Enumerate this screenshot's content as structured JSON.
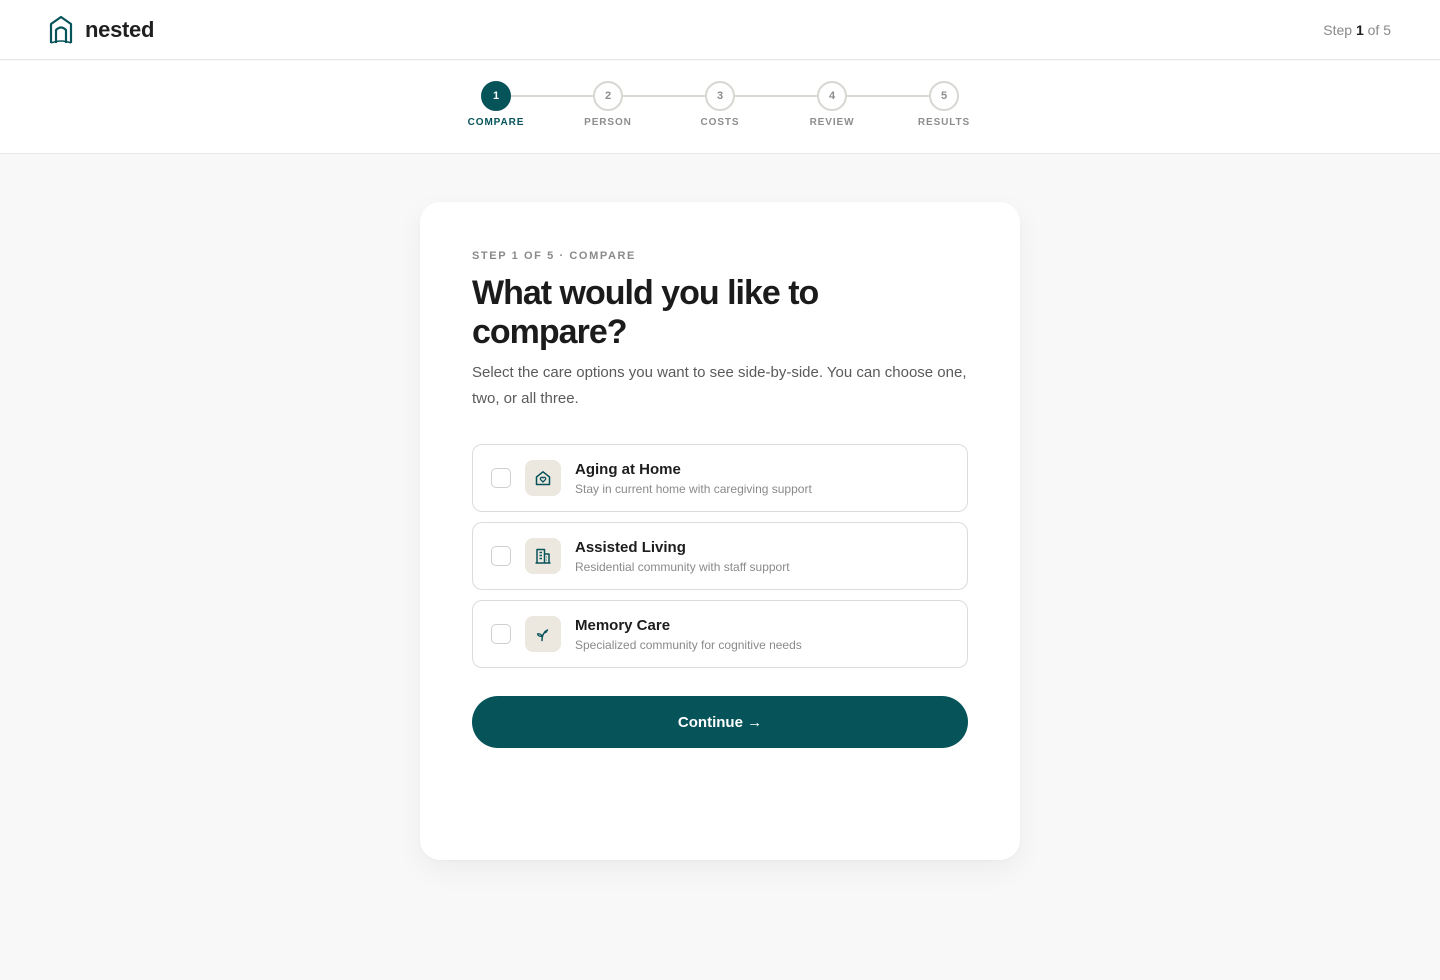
{
  "header": {
    "brand_name": "nested",
    "logo_icon": "house-arch-icon",
    "step_prefix": "Step ",
    "step_current": "1",
    "step_suffix": " of 5"
  },
  "progress": {
    "steps": [
      {
        "number": "1",
        "label": "COMPARE",
        "active": true
      },
      {
        "number": "2",
        "label": "PERSON",
        "active": false
      },
      {
        "number": "3",
        "label": "COSTS",
        "active": false
      },
      {
        "number": "4",
        "label": "REVIEW",
        "active": false
      },
      {
        "number": "5",
        "label": "RESULTS",
        "active": false
      }
    ]
  },
  "card": {
    "eyebrow": "STEP 1 OF 5 · COMPARE",
    "headline": "What would you like to compare?",
    "subtext": "Select the care options you want to see side-by-side. You can choose one, two, or all three.",
    "options": [
      {
        "title": "Aging at Home",
        "description": "Stay in current home with caregiving support",
        "icon": "home-heart-icon",
        "checked": false
      },
      {
        "title": "Assisted Living",
        "description": "Residential community with staff support",
        "icon": "building-icon",
        "checked": false
      },
      {
        "title": "Memory Care",
        "description": "Specialized community for cognitive needs",
        "icon": "sprout-icon",
        "checked": false
      }
    ],
    "continue_label": "Continue →"
  },
  "colors": {
    "accent": "#06535a",
    "background": "#f8f8f8",
    "icon_tile": "#ece8e0",
    "border": "#dcdcd8"
  }
}
